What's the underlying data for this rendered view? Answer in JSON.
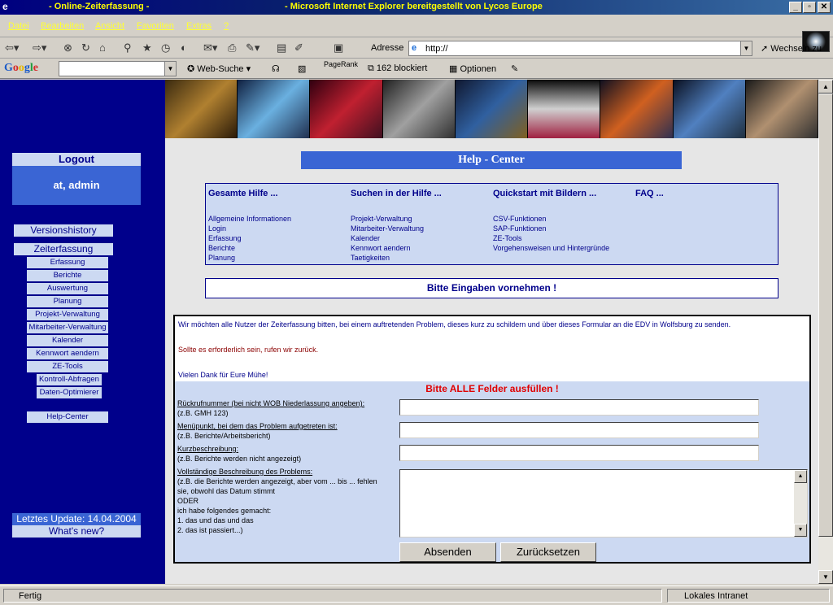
{
  "window": {
    "title_left": "- Online-Zeiterfassung -",
    "title_right": "- Microsoft Internet Explorer bereitgestellt von Lycos Europe",
    "min": "_",
    "max": "▫",
    "close": "✕"
  },
  "menu": [
    "Datei",
    "Bearbeiten",
    "Ansicht",
    "Favoriten",
    "Extras",
    "?"
  ],
  "toolbar": {
    "address_label": "Adresse",
    "address_value": "http://",
    "go_label": "Wechseln zu"
  },
  "google_bar": {
    "logo": "Google",
    "web_search": "Web-Suche",
    "pagerank": "PageRank",
    "blocked": "162 blockiert",
    "options": "Optionen"
  },
  "sidebar": {
    "logout": "Logout",
    "user": "at, admin",
    "versionshistory": "Versionshistory",
    "zeiterfassung": "Zeiterfassung",
    "sub": [
      "Erfassung",
      "Berichte",
      "Auswertung",
      "Planung",
      "Projekt-Verwaltung",
      "Mitarbeiter-Verwaltung",
      "Kalender",
      "Kennwort aendern",
      "ZE-Tools"
    ],
    "sub2": [
      "Kontroll-Abfragen",
      "Daten-Optimierer"
    ],
    "helpcenter": "Help-Center",
    "update": "Letztes Update: 14.04.2004",
    "whatsnew": "What's new?"
  },
  "help": {
    "title": "Help - Center",
    "columns": [
      {
        "head": "Gesamte Hilfe ...",
        "links": [
          "Allgemeine Informationen",
          "Login",
          "Erfassung",
          "Berichte",
          "Planung"
        ]
      },
      {
        "head": "Suchen in der Hilfe ...",
        "links": [
          "Projekt-Verwaltung",
          "Mitarbeiter-Verwaltung",
          "Kalender",
          "Kennwort aendern",
          "Taetigkeiten"
        ]
      },
      {
        "head": "Quickstart mit Bildern ...",
        "links": [
          "CSV-Funktionen",
          "SAP-Funktionen",
          "ZE-Tools",
          "Vorgehensweisen und Hintergründe"
        ]
      },
      {
        "head": "FAQ ...",
        "links": []
      }
    ],
    "bitte": "Bitte Eingaben vornehmen !"
  },
  "form": {
    "intro1": "Wir möchten alle Nutzer der Zeiterfassung bitten, bei einem auftretenden Problem, dieses kurz zu schildern und über dieses Formular an die EDV in Wolfsburg zu senden.",
    "intro2": "Sollte es erforderlich sein, rufen wir zurück.",
    "intro3": "Vielen Dank für Eure Mühe!",
    "alle": "Bitte ALLE Felder ausfüllen !",
    "f1_label": "Rückrufnummer (bei nicht WOB Niederlassung angeben):",
    "f1_hint": "(z.B. GMH 123)",
    "f2_label": "Menüpunkt, bei dem das Problem aufgetreten ist:",
    "f2_hint": "(z.B. Berichte/Arbeitsbericht)",
    "f3_label": "Kurzbeschreibung:",
    "f3_hint": "(z.B. Berichte werden nicht angezeigt)",
    "f4_label": "Vollständige Beschreibung des Problems:",
    "f4_hint": [
      "(z.B. die Berichte werden angezeigt, aber vom ... bis ... fehlen",
      "sie, obwohl das Datum stimmt",
      "ODER",
      "ich habe folgendes gemacht:",
      "1. das und das und das",
      "2. das ist passiert...)"
    ],
    "submit": "Absenden",
    "reset": "Zurücksetzen"
  },
  "status": {
    "left": "Fertig",
    "right": "Lokales Intranet"
  }
}
